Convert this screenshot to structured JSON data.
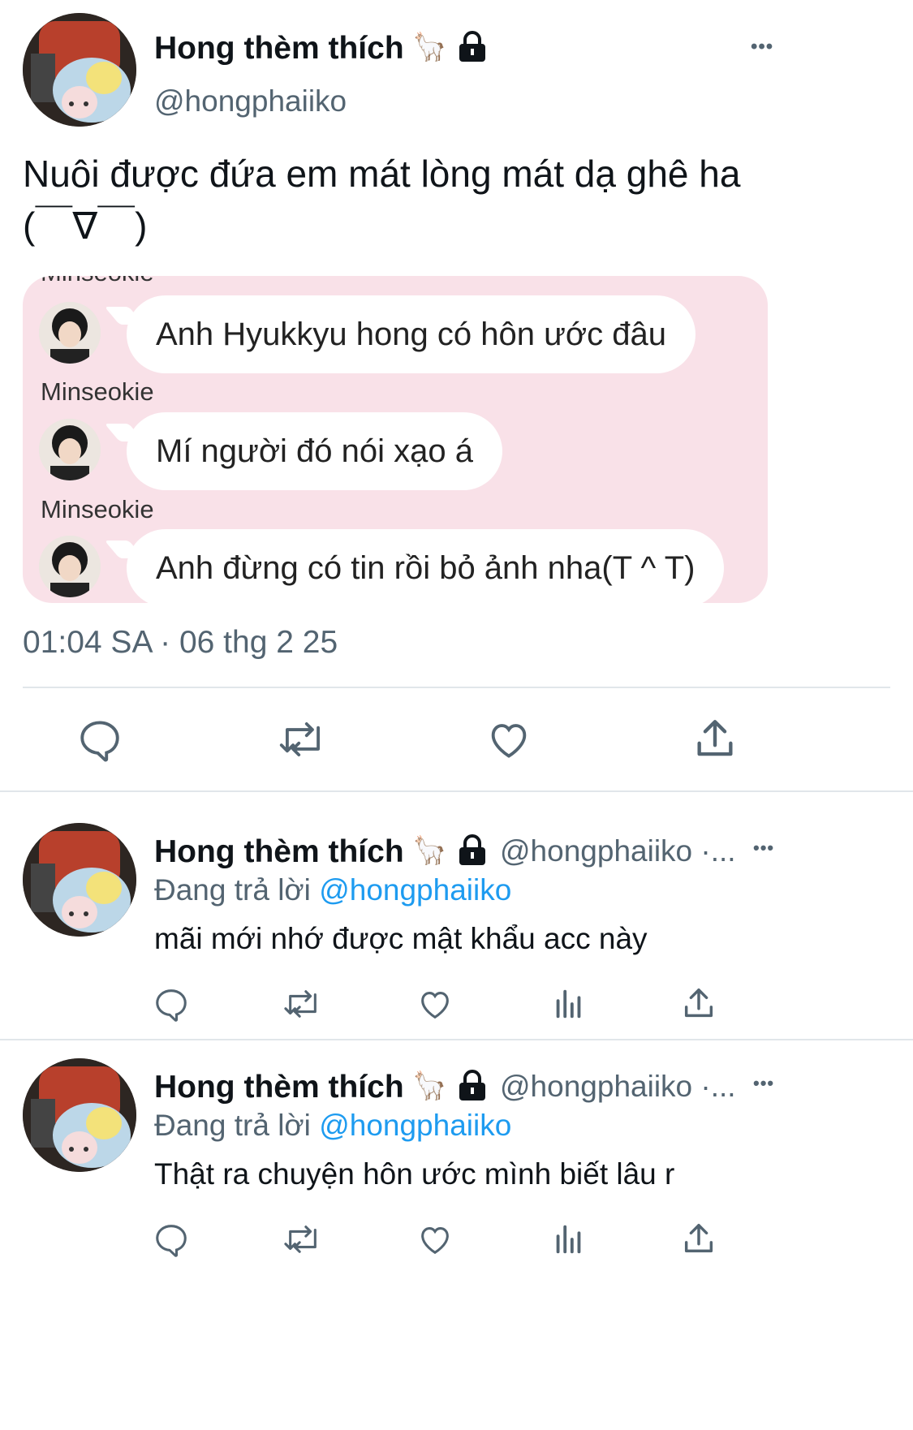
{
  "main_tweet": {
    "display_name": "Hong thèm thích",
    "name_emoji": "🦙",
    "handle": "@hongphaiiko",
    "more": "•••",
    "text_line1": "Nuôi được đứa em mát lòng mát dạ ghê ha",
    "text_line2": "(￣∇￣)",
    "timestamp": "01:04 SA · 06 thg 2 25"
  },
  "chat_card": {
    "cut_sender": "Minseokie",
    "messages": [
      {
        "sender": "",
        "text": "Anh Hyukkyu hong có hôn ước đâu"
      },
      {
        "sender": "Minseokie",
        "text": "Mí người đó nói xạo á"
      },
      {
        "sender": "Minseokie",
        "text": "Anh đừng có tin rồi bỏ ảnh nha(T ^ T)"
      }
    ]
  },
  "replies": [
    {
      "display_name": "Hong thèm thích",
      "name_emoji": "🦙",
      "handle": "@hongphaiiko ·...",
      "replying_prefix": "Đang trả lời",
      "replying_to": "@hongphaiiko",
      "text": "mãi mới nhớ được mật khẩu acc này",
      "more": "•••"
    },
    {
      "display_name": "Hong thèm thích",
      "name_emoji": "🦙",
      "handle": "@hongphaiiko ·...",
      "replying_prefix": "Đang trả lời",
      "replying_to": "@hongphaiiko",
      "text": "Thật ra chuyện hôn ước mình biết lâu r",
      "more": "•••"
    }
  ],
  "icons": [
    "reply-icon",
    "retweet-icon",
    "like-icon",
    "share-icon",
    "views-icon",
    "lock-icon",
    "more-icon"
  ],
  "colors": {
    "link": "#1d9bf0",
    "muted": "#536471",
    "card_bg": "#f9e1e8"
  }
}
